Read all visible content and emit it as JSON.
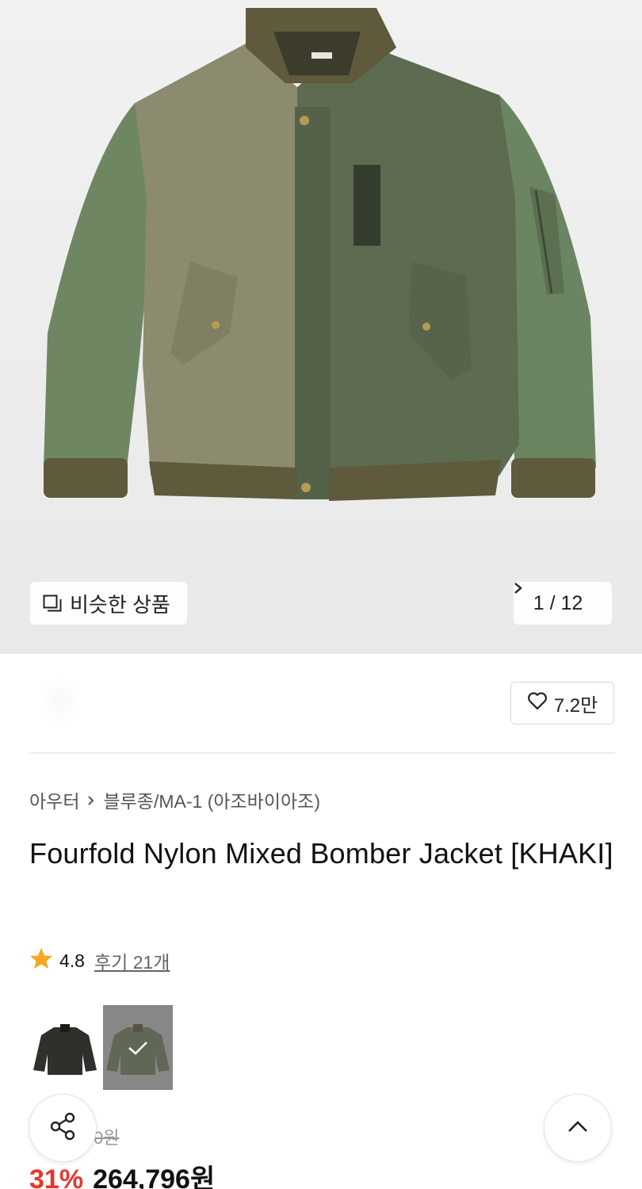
{
  "gallery": {
    "similar_label": "비슷한 상품",
    "counter": "1 / 12",
    "brand_tag": "LOOKAST"
  },
  "product": {
    "likes": "7.2만",
    "breadcrumb": {
      "category": "아우터",
      "subcategory": "블루종/MA-1 (아조바이아조)"
    },
    "title": "Fourfold Nylon Mixed Bomber Jacket [KHAKI]",
    "rating": "4.8",
    "reviews": "후기 21개",
    "swatches": [
      {
        "name": "black",
        "selected": false
      },
      {
        "name": "khaki",
        "selected": true
      }
    ],
    "original_price": "0원",
    "discount": "31%",
    "price": "264,796원"
  },
  "colors": {
    "discount": "#e8352a",
    "star": "#f5a623"
  },
  "icons": [
    "image-stack-icon",
    "chevron-right-icon",
    "heart-icon",
    "star-icon",
    "check-icon",
    "share-icon",
    "chevron-up-icon"
  ]
}
